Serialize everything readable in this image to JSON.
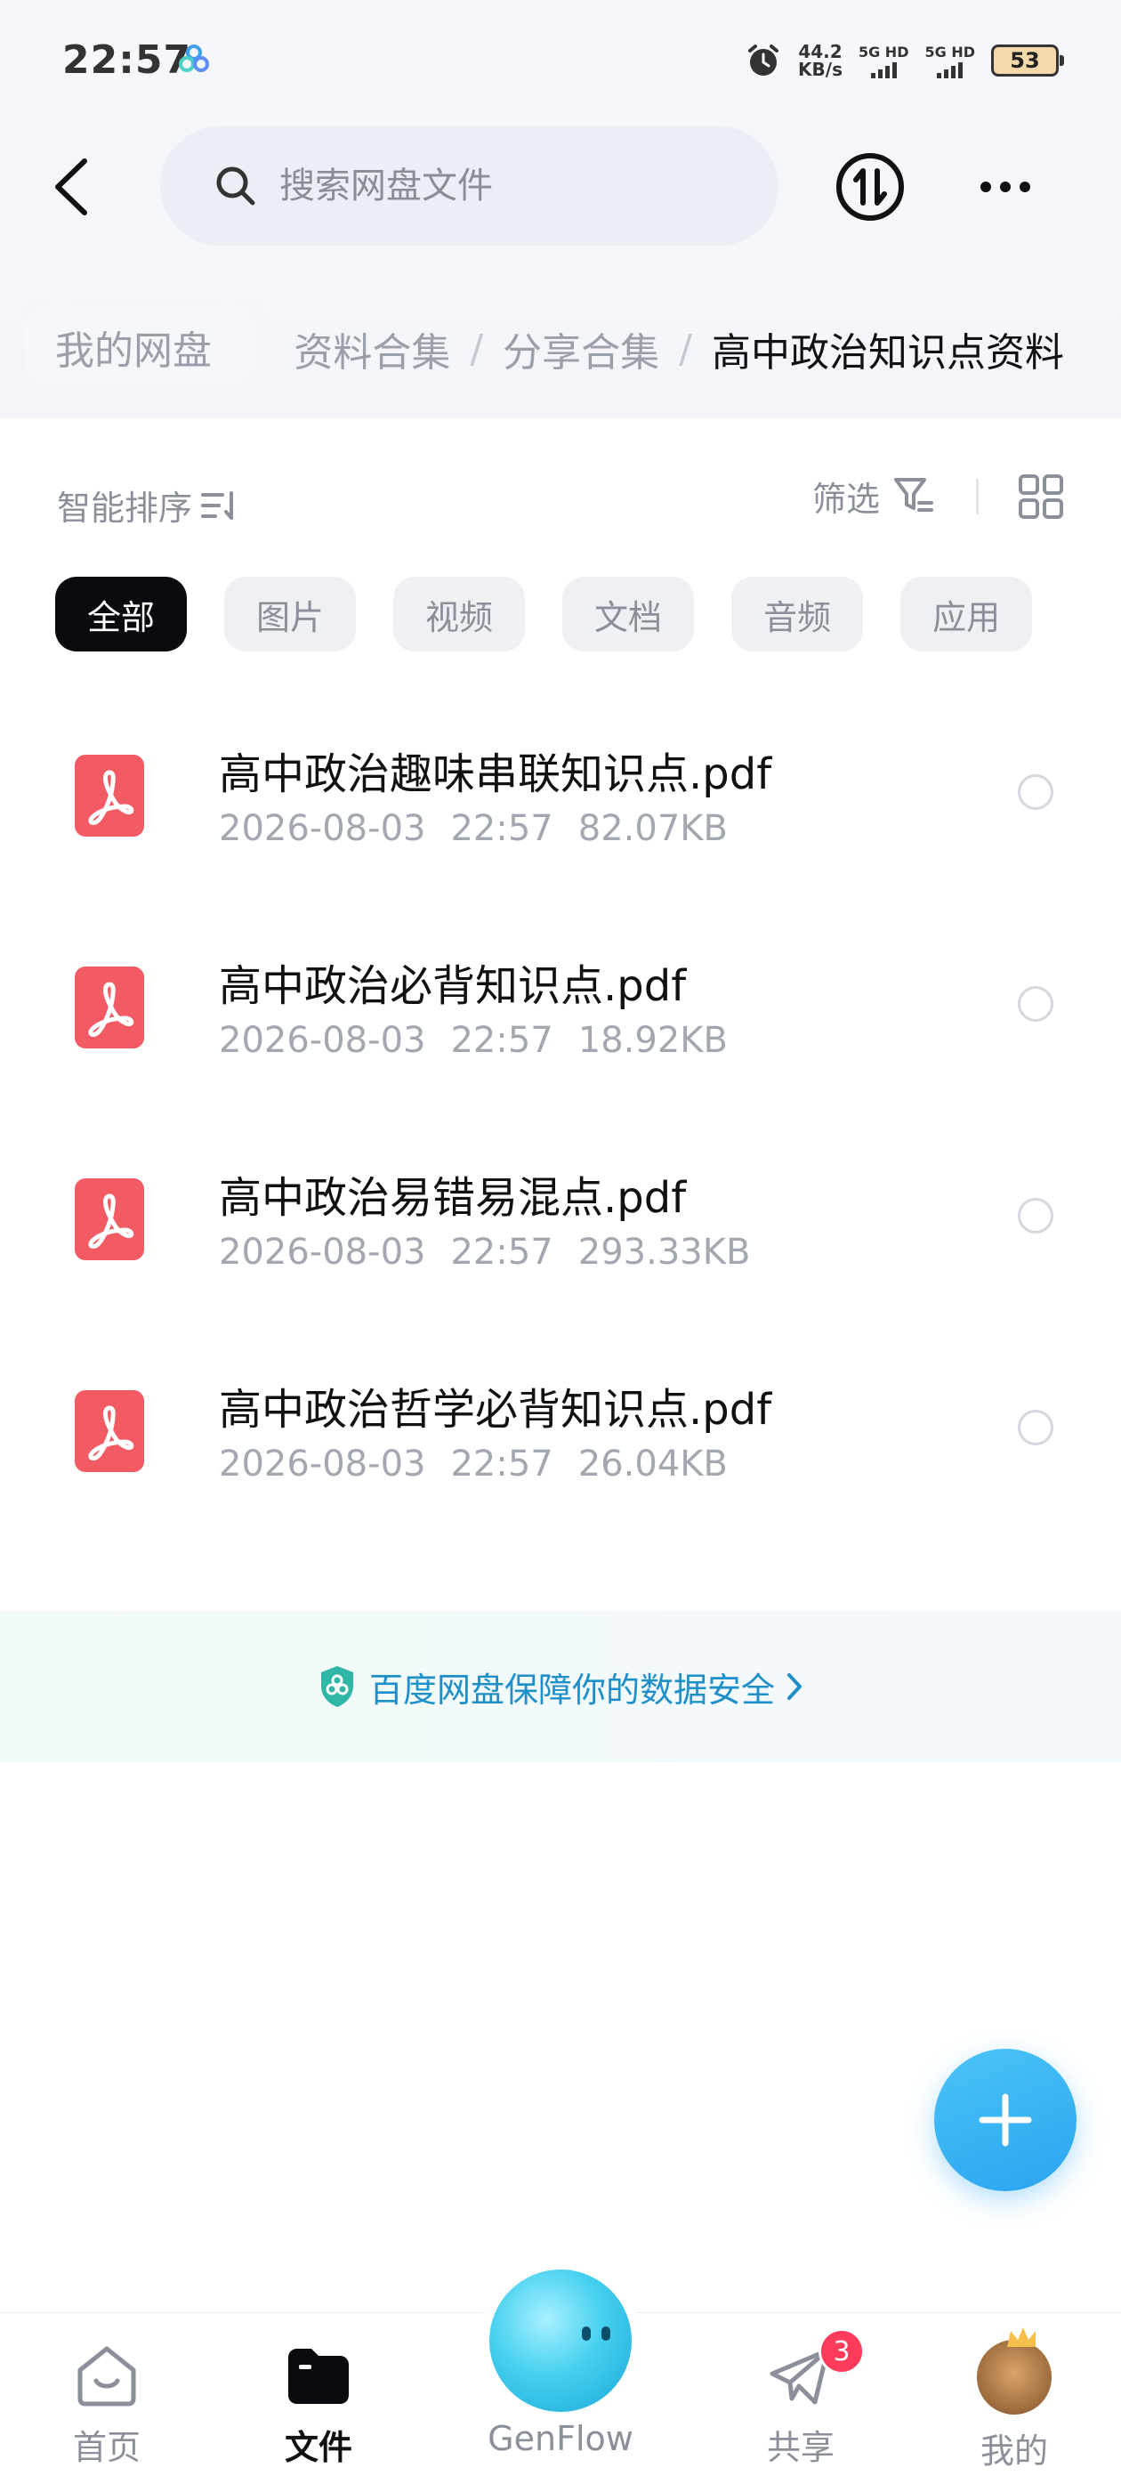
{
  "status_bar": {
    "time": "22:57",
    "net_speed_value": "44.2",
    "net_speed_unit": "KB/s",
    "signal1": "5G HD",
    "signal2": "5G HD",
    "battery": "53"
  },
  "header": {
    "search_placeholder": "搜索网盘文件"
  },
  "breadcrumb": {
    "root": "我的网盘",
    "items": [
      "资料合集",
      "分享合集",
      "高中政治知识点资料"
    ],
    "separator": "/"
  },
  "toolbar": {
    "sort_label": "智能排序",
    "filter_label": "筛选"
  },
  "chips": [
    "全部",
    "图片",
    "视频",
    "文档",
    "音频",
    "应用"
  ],
  "files": [
    {
      "name": "高中政治趣味串联知识点.pdf",
      "date": "2026-08-03",
      "time": "22:57",
      "size": "82.07KB"
    },
    {
      "name": "高中政治必背知识点.pdf",
      "date": "2026-08-03",
      "time": "22:57",
      "size": "18.92KB"
    },
    {
      "name": "高中政治易错易混点.pdf",
      "date": "2026-08-03",
      "time": "22:57",
      "size": "293.33KB"
    },
    {
      "name": "高中政治哲学必背知识点.pdf",
      "date": "2026-08-03",
      "time": "22:57",
      "size": "26.04KB"
    }
  ],
  "security_banner": "百度网盘保障你的数据安全",
  "bottom_nav": {
    "home": "首页",
    "files": "文件",
    "genflow": "GenFlow",
    "share": "共享",
    "mine": "我的",
    "share_badge": "3"
  },
  "colors": {
    "accent": "#2aa4f0",
    "pdf_icon": "#f25a64",
    "active_chip": "#0b0b0f",
    "badge": "#ff3b5c"
  }
}
